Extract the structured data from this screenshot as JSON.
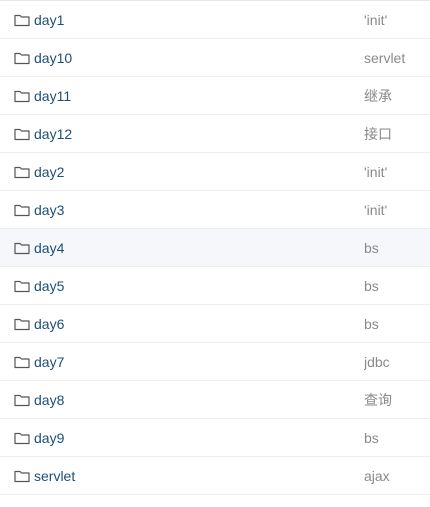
{
  "colors": {
    "link": "#1d4f78",
    "message": "#8a8a8a",
    "row_border": "#ececec",
    "highlight_row": "#f5f7fa"
  },
  "rows": [
    {
      "icon": "folder-icon",
      "name": "day1",
      "message": "'init'",
      "highlighted": false
    },
    {
      "icon": "folder-icon",
      "name": "day10",
      "message": "servlet",
      "highlighted": false
    },
    {
      "icon": "folder-icon",
      "name": "day11",
      "message": "继承",
      "highlighted": false
    },
    {
      "icon": "folder-icon",
      "name": "day12",
      "message": "接口",
      "highlighted": false
    },
    {
      "icon": "folder-icon",
      "name": "day2",
      "message": "'init'",
      "highlighted": false
    },
    {
      "icon": "folder-icon",
      "name": "day3",
      "message": "'init'",
      "highlighted": false
    },
    {
      "icon": "folder-icon",
      "name": "day4",
      "message": "bs",
      "highlighted": true
    },
    {
      "icon": "folder-icon",
      "name": "day5",
      "message": "bs",
      "highlighted": false
    },
    {
      "icon": "folder-icon",
      "name": "day6",
      "message": "bs",
      "highlighted": false
    },
    {
      "icon": "folder-icon",
      "name": "day7",
      "message": "jdbc",
      "highlighted": false
    },
    {
      "icon": "folder-icon",
      "name": "day8",
      "message": "查询",
      "highlighted": false
    },
    {
      "icon": "folder-icon",
      "name": "day9",
      "message": "bs",
      "highlighted": false
    },
    {
      "icon": "folder-icon",
      "name": "servlet",
      "message": "ajax",
      "highlighted": false
    }
  ]
}
